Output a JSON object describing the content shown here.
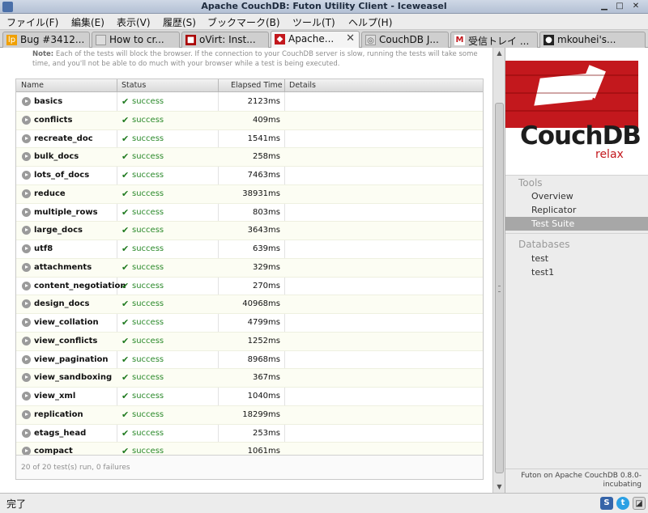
{
  "window": {
    "title": "Apache CouchDB: Futon Utility Client - Iceweasel"
  },
  "menubar": [
    "ファイル(F)",
    "編集(E)",
    "表示(V)",
    "履歴(S)",
    "ブックマーク(B)",
    "ツール(T)",
    "ヘルプ(H)"
  ],
  "tabs": [
    {
      "label": "Bug #3412...",
      "icon": "launchpad-icon"
    },
    {
      "label": "How to cr...",
      "icon": "page-icon"
    },
    {
      "label": "oVirt: Inst...",
      "icon": "ovirt-icon"
    },
    {
      "label": "Apache...",
      "icon": "couchdb-icon",
      "active": true
    },
    {
      "label": "CouchDB J...",
      "icon": "page-icon"
    },
    {
      "label": "受信トレイ ...",
      "icon": "gmail-icon"
    },
    {
      "label": "mkouhei's...",
      "icon": "github-icon"
    }
  ],
  "note": {
    "label": "Note:",
    "text": "Each of the tests will block the browser. If the connection to your CouchDB server is slow, running the tests will take some time, and you'll not be able to do much with your browser while a test is being executed."
  },
  "table": {
    "headers": {
      "name": "Name",
      "status": "Status",
      "elapsed": "Elapsed Time",
      "details": "Details"
    },
    "rows": [
      {
        "name": "basics",
        "status": "success",
        "elapsed": "2123ms"
      },
      {
        "name": "conflicts",
        "status": "success",
        "elapsed": "409ms"
      },
      {
        "name": "recreate_doc",
        "status": "success",
        "elapsed": "1541ms"
      },
      {
        "name": "bulk_docs",
        "status": "success",
        "elapsed": "258ms"
      },
      {
        "name": "lots_of_docs",
        "status": "success",
        "elapsed": "7463ms"
      },
      {
        "name": "reduce",
        "status": "success",
        "elapsed": "38931ms"
      },
      {
        "name": "multiple_rows",
        "status": "success",
        "elapsed": "803ms"
      },
      {
        "name": "large_docs",
        "status": "success",
        "elapsed": "3643ms"
      },
      {
        "name": "utf8",
        "status": "success",
        "elapsed": "639ms"
      },
      {
        "name": "attachments",
        "status": "success",
        "elapsed": "329ms"
      },
      {
        "name": "content_negotiation",
        "status": "success",
        "elapsed": "270ms"
      },
      {
        "name": "design_docs",
        "status": "success",
        "elapsed": "40968ms"
      },
      {
        "name": "view_collation",
        "status": "success",
        "elapsed": "4799ms"
      },
      {
        "name": "view_conflicts",
        "status": "success",
        "elapsed": "1252ms"
      },
      {
        "name": "view_pagination",
        "status": "success",
        "elapsed": "8968ms"
      },
      {
        "name": "view_sandboxing",
        "status": "success",
        "elapsed": "367ms"
      },
      {
        "name": "view_xml",
        "status": "success",
        "elapsed": "1040ms"
      },
      {
        "name": "replication",
        "status": "success",
        "elapsed": "18299ms"
      },
      {
        "name": "etags_head",
        "status": "success",
        "elapsed": "253ms"
      },
      {
        "name": "compact",
        "status": "success",
        "elapsed": "1061ms"
      }
    ],
    "footer": "20 of 20 test(s) run, 0 failures"
  },
  "sidebar": {
    "logo_word": "CouchDB",
    "logo_tagline": "relax",
    "tools_title": "Tools",
    "tools": [
      "Overview",
      "Replicator",
      "Test Suite"
    ],
    "selected_tool": "Test Suite",
    "databases_title": "Databases",
    "databases": [
      "test",
      "test1"
    ],
    "footer_line1": "Futon on Apache CouchDB 0.8.0-",
    "footer_line2": "incubating"
  },
  "statusbar": {
    "text": "完了"
  },
  "colors": {
    "accent_red": "#c3181d",
    "success_green": "#2b8a2b",
    "selected_bg": "#a7a7a7"
  }
}
